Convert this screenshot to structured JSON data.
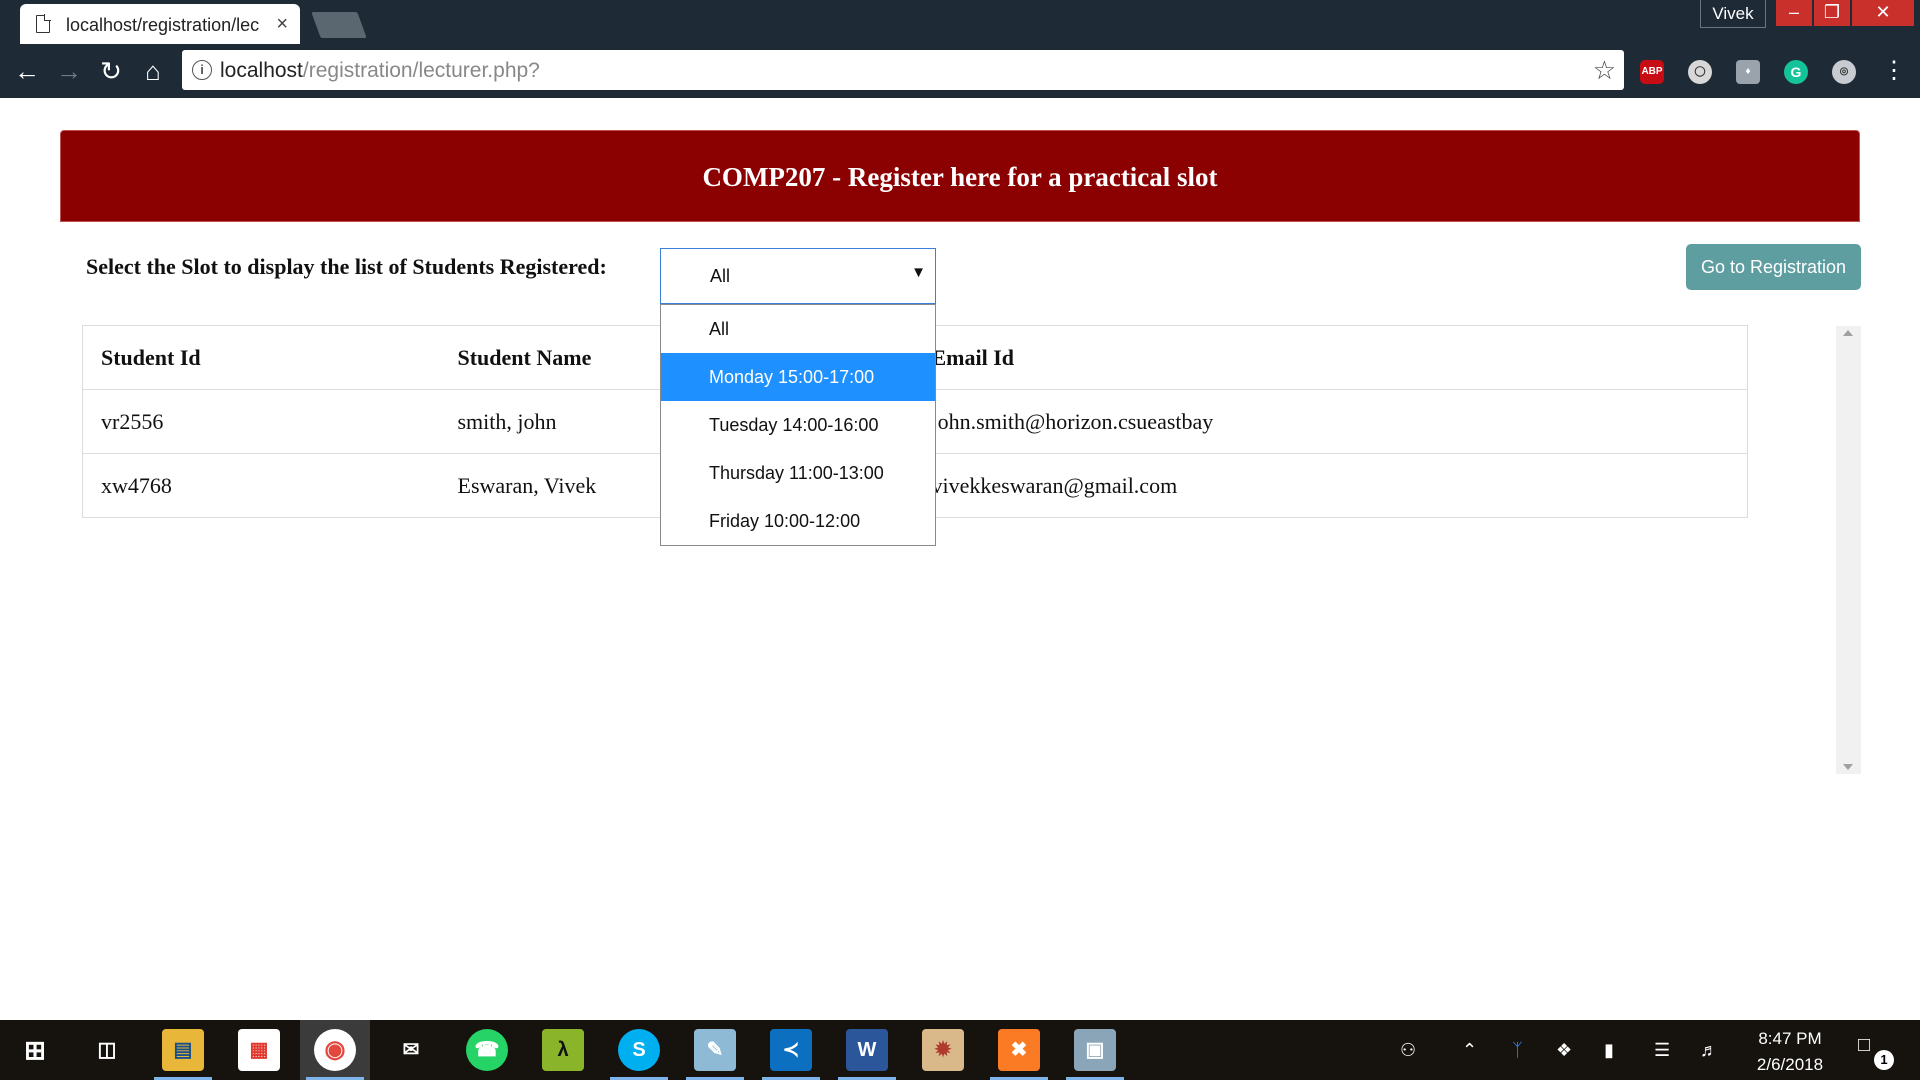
{
  "browser": {
    "tab_title": "localhost/registration/lec",
    "tab_close_glyph": "×",
    "user_name": "Vivek",
    "url_host": "localhost",
    "url_path": "/registration/lecturer.php?",
    "ext_abp_label": "ABP",
    "ext_grammarly_label": "G"
  },
  "page": {
    "banner_title": "COMP207 - Register here for a practical slot",
    "select_label": "Select the Slot to display the list of Students Registered:",
    "selected_slot": "All",
    "slot_options": [
      "All",
      "Monday 15:00-17:00",
      "Tuesday 14:00-16:00",
      "Thursday 11:00-13:00",
      "Friday 10:00-12:00"
    ],
    "highlighted_option": "Monday 15:00-17:00",
    "goto_button": "Go to Registration",
    "table": {
      "headers": [
        "Student Id",
        "Student Name",
        "Email Id"
      ],
      "rows": [
        [
          "vr2556",
          "smith, john",
          "john.smith@horizon.csueastbay"
        ],
        [
          "xw4768",
          "Eswaran, Vivek",
          "vivekkeswaran@gmail.com"
        ]
      ]
    }
  },
  "taskbar": {
    "time": "8:47 PM",
    "date": "2/6/2018",
    "notification_count": "1",
    "apps": [
      "windows-start",
      "task-view",
      "file-explorer",
      "store",
      "chrome",
      "mail",
      "whatsapp",
      "lambda-app",
      "skype",
      "notepad",
      "vscode",
      "word",
      "paint",
      "xampp",
      "app-installer"
    ]
  },
  "colors": {
    "banner": "#8b0000",
    "button": "#5f9ea0",
    "selection": "#1e90ff",
    "chrome_frame": "#1e2a36"
  }
}
